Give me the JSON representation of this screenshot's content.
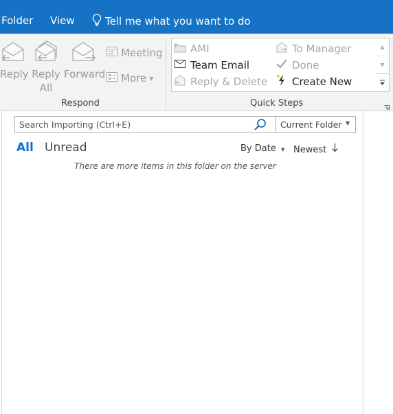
{
  "tabs": [
    {
      "label": "Folder"
    },
    {
      "label": "View"
    }
  ],
  "tell_me": {
    "label": "Tell me what you want to do"
  },
  "respond": {
    "group_label": "Respond",
    "reply": "Reply",
    "reply_all_1": "Reply",
    "reply_all_2": "All",
    "forward": "Forward",
    "meeting": "Meeting",
    "more": "More"
  },
  "quick_steps": {
    "group_label": "Quick Steps",
    "items": [
      {
        "label": "AMI"
      },
      {
        "label": "Team Email"
      },
      {
        "label": "Reply & Delete"
      },
      {
        "label": "To Manager"
      },
      {
        "label": "Done"
      },
      {
        "label": "Create New"
      }
    ]
  },
  "search": {
    "placeholder": "Search Importing (Ctrl+E)",
    "scope": "Current Folder"
  },
  "filters": {
    "all": "All",
    "unread": "Unread"
  },
  "sort": {
    "by": "By Date",
    "order": "Newest"
  },
  "message": "There are more items in this folder on the server",
  "colors": {
    "tabbar": "#1572c4",
    "accent": "#1570c6"
  }
}
